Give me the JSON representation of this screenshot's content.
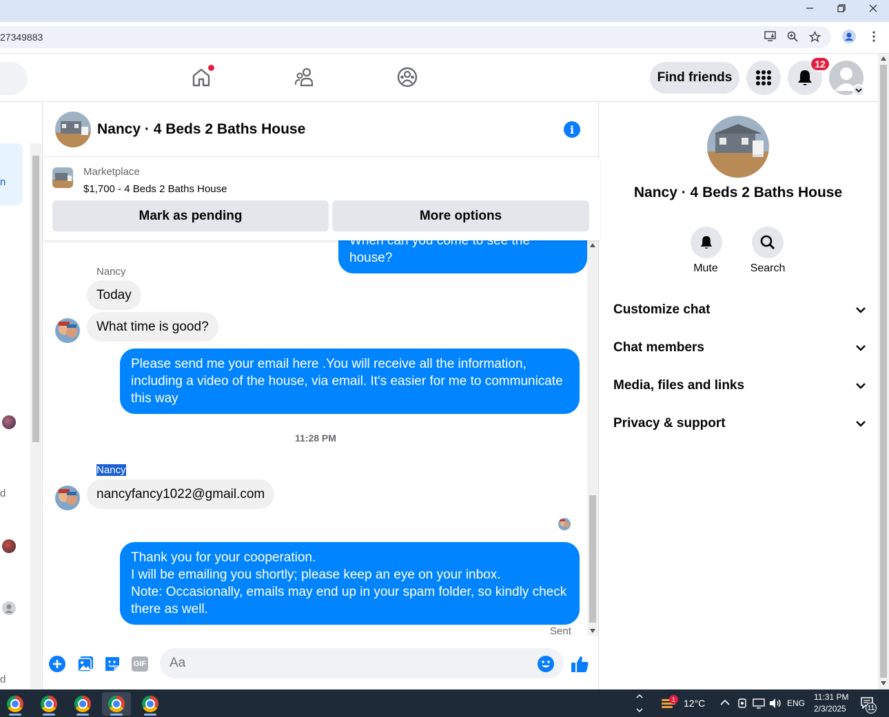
{
  "browser": {
    "url_fragment": "27349883",
    "window_controls": [
      "minimize",
      "restore",
      "close"
    ]
  },
  "topnav": {
    "find_friends_label": "Find friends",
    "notification_count": "12"
  },
  "chat": {
    "title": "Nancy · 4 Beds 2 Baths House",
    "marketplace_label": "Marketplace",
    "listing": "$1,700 - 4 Beds 2 Baths House",
    "mark_pending_label": "Mark as pending",
    "more_options_label": "More options",
    "partial_msg": "When can you come to see the house?",
    "sender_name_1": "Nancy",
    "msg_today": "Today",
    "msg_what_time": "What time is good?",
    "msg_send_email": "Please send me your email here .You will receive all the information, including a video of the house, via email. It's easier for me to communicate this way",
    "timestamp": "11:28 PM",
    "sender_name_2": "Nancy",
    "msg_email": "nancyfancy1022@gmail.com",
    "msg_thanks_1": "Thank you for your cooperation.",
    "msg_thanks_2": "I will be emailing you shortly; please keep an eye on your inbox.",
    "msg_thanks_3": "Note: Occasionally, emails may end up in your spam folder, so kindly check there as well.",
    "sent_label": "Sent",
    "composer_placeholder": "Aa",
    "gif_label": "GIF"
  },
  "left_list": {
    "fragments": [
      "n",
      "d",
      "d"
    ]
  },
  "info_panel": {
    "name": "Nancy · 4 Beds 2 Baths House",
    "mute_label": "Mute",
    "search_label": "Search",
    "sections": [
      "Customize chat",
      "Chat members",
      "Media, files and links",
      "Privacy & support"
    ]
  },
  "taskbar": {
    "weather_badge": "1",
    "temperature": "12°C",
    "language": "ENG",
    "time": "11:31 PM",
    "date": "2/3/2025",
    "notification_count": "11"
  },
  "colors": {
    "messenger_blue": "#0084ff",
    "fb_blue": "#0a7cff",
    "badge_red": "#e41e3f"
  }
}
